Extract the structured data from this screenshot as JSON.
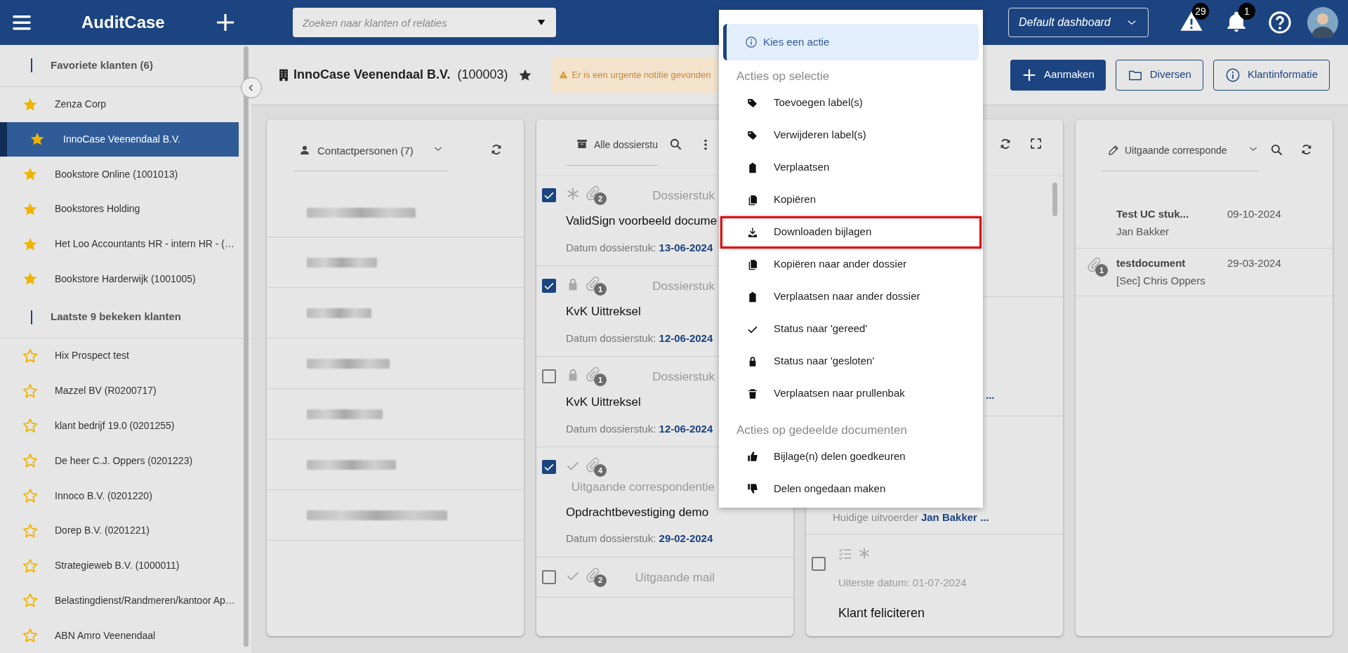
{
  "header": {
    "app_title": "AuditCase",
    "search": {
      "placeholder": "Zoeken naar klanten of relaties"
    },
    "dashboard": {
      "value": "Default dashboard"
    },
    "alerts_badge": "29",
    "notifications_badge": "1"
  },
  "sidebar": {
    "sections": [
      {
        "title": "Favoriete klanten (6)",
        "items": [
          {
            "label": "Zenza Corp",
            "favorite": true,
            "selected": false
          },
          {
            "label": "InnoCase Veenendaal B.V.",
            "favorite": true,
            "selected": true
          },
          {
            "label": "Bookstore Online (1001013)",
            "favorite": true,
            "selected": false
          },
          {
            "label": "Bookstores Holding",
            "favorite": true,
            "selected": false
          },
          {
            "label": "Het Loo Accountants HR - intern HR - (…",
            "favorite": true,
            "selected": false
          },
          {
            "label": "Bookstore Harderwijk (1001005)",
            "favorite": true,
            "selected": false
          }
        ]
      },
      {
        "title": "Laatste 9 bekeken klanten",
        "items": [
          {
            "label": "Hix Prospect test",
            "favorite": false,
            "selected": false
          },
          {
            "label": "Mazzel BV (R0200717)",
            "favorite": false,
            "selected": false
          },
          {
            "label": "klant bedrijf 19.0 (0201255)",
            "favorite": false,
            "selected": false
          },
          {
            "label": "De heer C.J. Oppers (0201223)",
            "favorite": false,
            "selected": false
          },
          {
            "label": "Innoco B.V. (0201220)",
            "favorite": false,
            "selected": false
          },
          {
            "label": "Dorep B.V. (0201221)",
            "favorite": false,
            "selected": false
          },
          {
            "label": "Strategieweb B.V. (1000011)",
            "favorite": false,
            "selected": false
          },
          {
            "label": "Belastingdienst/Randmeren/kantoor Ap…",
            "favorite": false,
            "selected": false
          },
          {
            "label": "ABN Amro Veenendaal",
            "favorite": false,
            "selected": false
          }
        ]
      }
    ]
  },
  "client": {
    "name": "InnoCase Veenendaal B.V.",
    "number": "(100003)",
    "favorite": true,
    "notice": "Er is een urgente notitie gevonden"
  },
  "actions": [
    {
      "label": "Aanmaken",
      "kind": "primary"
    },
    {
      "label": "Diversen",
      "kind": "outline"
    },
    {
      "label": "Klantinformatie",
      "kind": "outline"
    }
  ],
  "contacts_panel": {
    "title": "Contactpersonen (7)"
  },
  "documents_panel": {
    "filter": "Alle dossierstu",
    "items": [
      {
        "checked": true,
        "kind": "new",
        "attachments": "2",
        "type": "Dossierstuk",
        "title": "ValidSign voorbeeld docume",
        "date_label": "Datum dossierstuk:",
        "date": "13-06-2024"
      },
      {
        "checked": true,
        "kind": "locked",
        "attachments": "1",
        "type": "Dossierstuk",
        "title": "KvK Uittreksel",
        "date_label": "Datum dossierstuk:",
        "date": "12-06-2024"
      },
      {
        "checked": false,
        "kind": "locked",
        "attachments": "1",
        "type": "Dossierstuk",
        "title": "KvK Uittreksel",
        "date_label": "Datum dossierstuk:",
        "date": "12-06-2024"
      },
      {
        "checked": true,
        "kind": "done",
        "attachments": "4",
        "type": "Uitgaande correspondentie",
        "title": "Opdrachtbevestiging demo",
        "date_label": "Datum dossierstuk:",
        "date": "29-02-2024"
      },
      {
        "checked": false,
        "kind": "done",
        "attachments": "2",
        "type": "Uitgaande mail"
      }
    ]
  },
  "tasks_panel": {
    "rows": [
      {
        "kind": "ellipsis",
        "text": "..."
      },
      {
        "kind": "assignee",
        "label": "Huidige uitvoerder",
        "value": "Jan Bakker ..."
      },
      {
        "kind": "task",
        "checked": false,
        "deadline": "Uiterste datum: 01-07-2024",
        "title": "Klant feliciteren"
      }
    ]
  },
  "correspondence_panel": {
    "filter": "Uitgaande corresponde",
    "items": [
      {
        "title": "Test UC stuk...",
        "date": "09-10-2024",
        "person": "Jan Bakker"
      },
      {
        "title": "testdocument",
        "date": "29-03-2024",
        "person": "[Sec] Chris Oppers",
        "attachments": "1"
      }
    ]
  },
  "action_menu": {
    "header": "Kies een actie",
    "groups": [
      {
        "title": "Acties op selectie",
        "items": [
          {
            "label": "Toevoegen label(s)",
            "highlighted": false
          },
          {
            "label": "Verwijderen label(s)",
            "highlighted": false
          },
          {
            "label": "Verplaatsen",
            "highlighted": false
          },
          {
            "label": "Kopiëren",
            "highlighted": false
          },
          {
            "label": "Downloaden bijlagen",
            "highlighted": true
          },
          {
            "label": "Kopiëren naar ander dossier",
            "highlighted": false
          },
          {
            "label": "Verplaatsen naar ander dossier",
            "highlighted": false
          },
          {
            "label": "Status naar 'gereed'",
            "highlighted": false
          },
          {
            "label": "Status naar 'gesloten'",
            "highlighted": false
          },
          {
            "label": "Verplaatsen naar prullenbak",
            "highlighted": false
          }
        ]
      },
      {
        "title": "Acties op gedeelde documenten",
        "items": [
          {
            "label": "Bijlage(n) delen goedkeuren",
            "highlighted": false
          },
          {
            "label": "Delen ongedaan maken",
            "highlighted": false
          }
        ]
      }
    ]
  }
}
